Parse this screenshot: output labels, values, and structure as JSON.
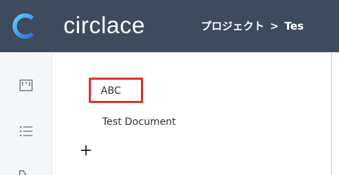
{
  "header": {
    "app_name": "circlace",
    "breadcrumb": {
      "project": "プロジェクト",
      "separator": ">",
      "current": "Tes"
    },
    "background_color": "#3d4b5d"
  },
  "sidebar": {
    "icons": [
      "board-icon",
      "list-icon",
      "page-icon"
    ]
  },
  "main": {
    "items": [
      {
        "label": "ABC",
        "highlighted": true,
        "highlight_color": "#d9322a"
      },
      {
        "label": "Test Document",
        "highlighted": false
      }
    ],
    "add_label": "+"
  }
}
